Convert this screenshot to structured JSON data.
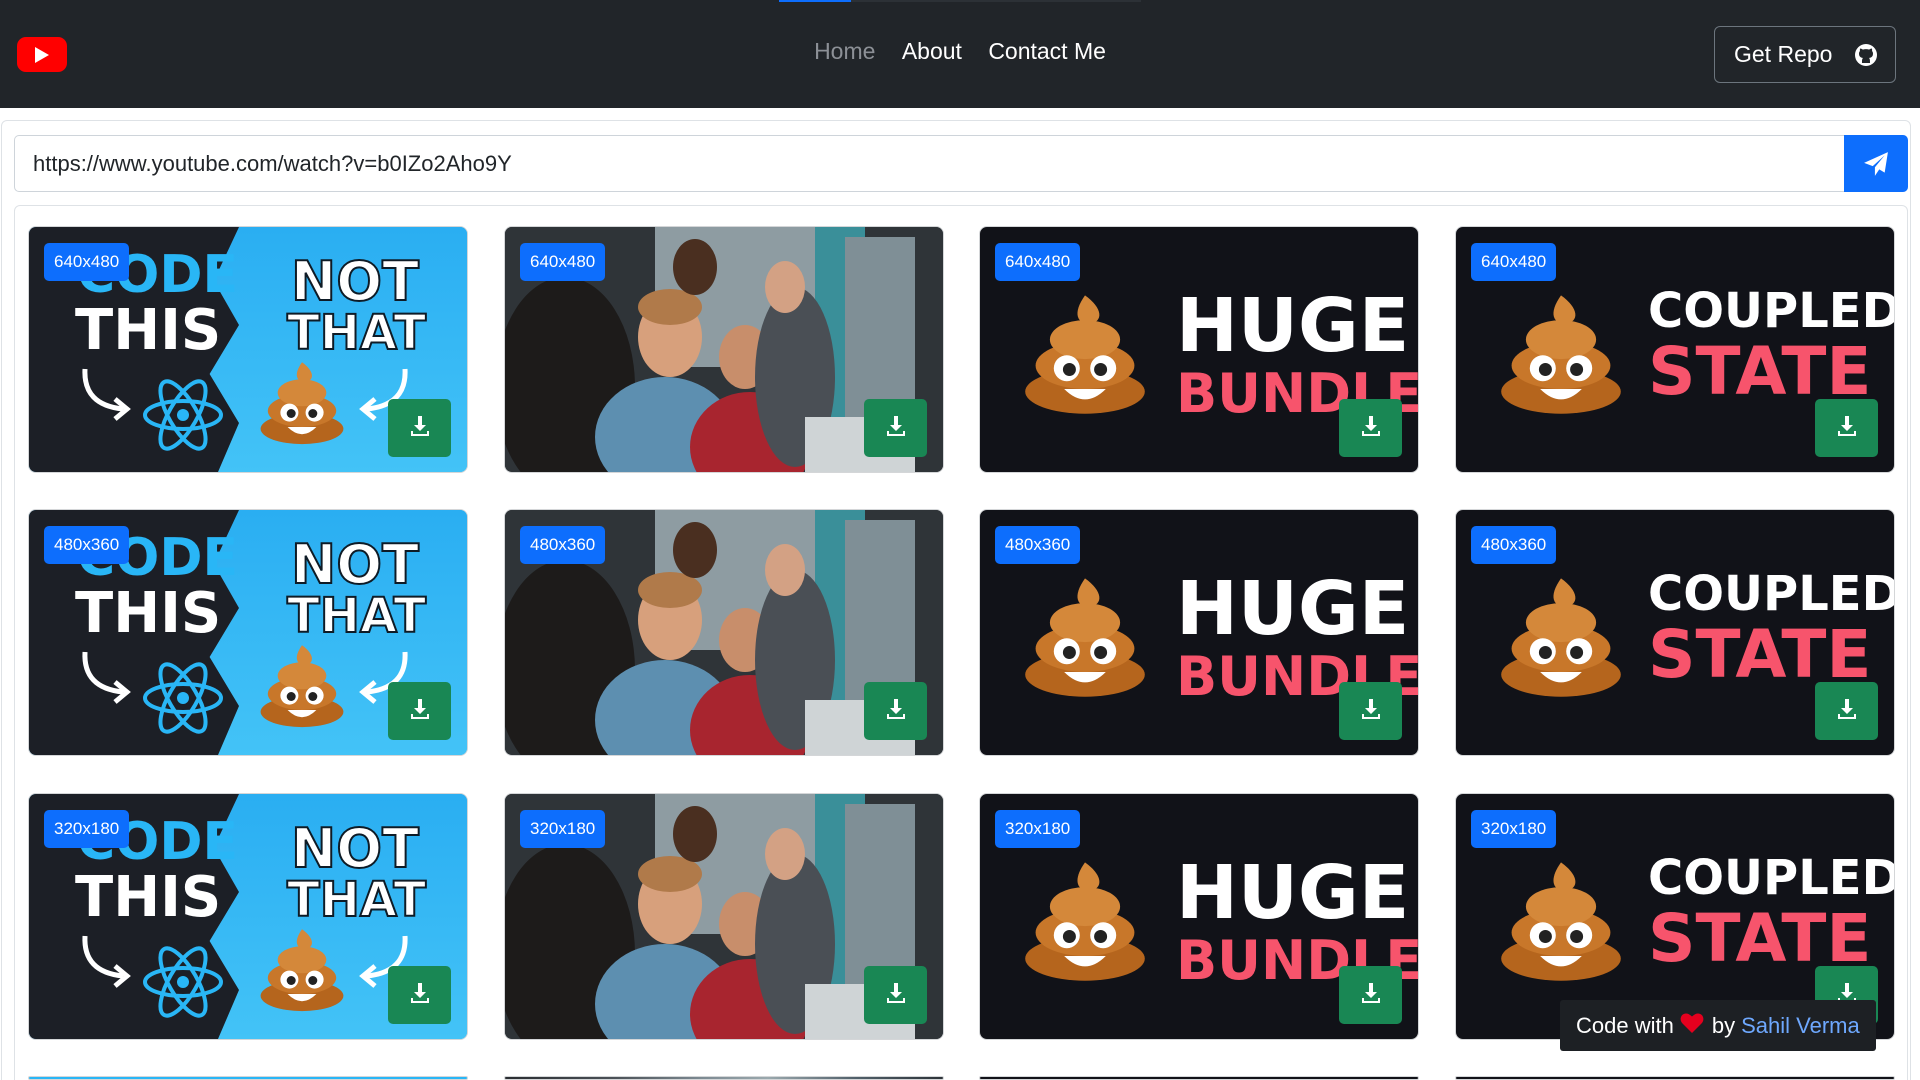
{
  "nav": {
    "links": [
      {
        "label": "Home",
        "active": false
      },
      {
        "label": "About",
        "active": true
      },
      {
        "label": "Contact Me",
        "active": true
      }
    ],
    "repo_button": "Get Repo"
  },
  "search": {
    "value": "https://www.youtube.com/watch?v=b0IZo2Aho9Y"
  },
  "thumbnails": {
    "rows": [
      {
        "size": "640x480"
      },
      {
        "size": "480x360"
      },
      {
        "size": "320x180"
      }
    ],
    "columns": [
      {
        "type": "code-this-not-that",
        "text": [
          "CODE",
          "THIS",
          "NOT",
          "THAT"
        ]
      },
      {
        "type": "photo"
      },
      {
        "type": "huge-bundle",
        "text": [
          "HUGE",
          "BUNDLE"
        ]
      },
      {
        "type": "coupled-state",
        "text": [
          "COUPLED",
          "STATE"
        ]
      }
    ]
  },
  "footer": {
    "prefix": "Code with",
    "by": "by",
    "author": "Sahil Verma"
  },
  "colors": {
    "navbar": "#212529",
    "primary": "#0d6efd",
    "success": "#198754",
    "youtube_red": "#ff0000",
    "accent_pink": "#f7546c"
  },
  "icons": {
    "logo": "youtube-logo-icon",
    "repo": "github-icon",
    "send": "paper-plane-icon",
    "download": "download-icon",
    "heart": "heart-icon"
  }
}
